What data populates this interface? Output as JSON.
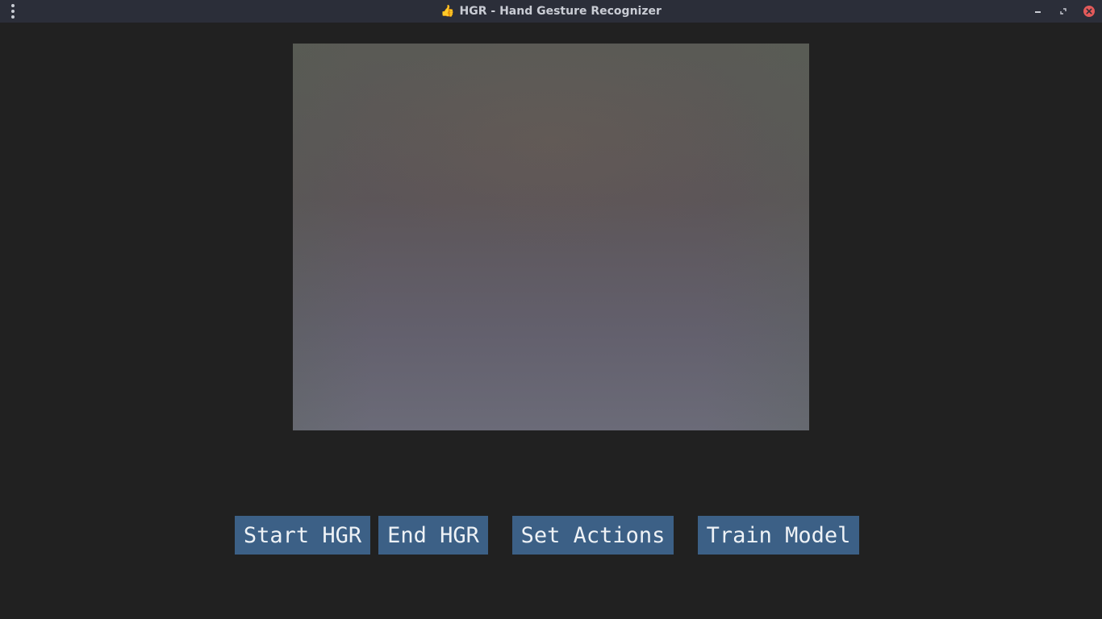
{
  "window": {
    "title_emoji": "👍",
    "title": "HGR - Hand Gesture Recognizer",
    "controls": {
      "menu_icon": "vertical-dots-icon",
      "minimize_icon": "minimize-icon",
      "restore_icon": "restore-icon",
      "close_icon": "close-icon",
      "close_color": "#e35a5a"
    }
  },
  "camera": {
    "description_icon": "webcam-feed"
  },
  "buttons": {
    "start": "Start HGR",
    "end": "End HGR",
    "set_actions": "Set Actions",
    "train_model": "Train Model",
    "color": "#3c6086"
  }
}
